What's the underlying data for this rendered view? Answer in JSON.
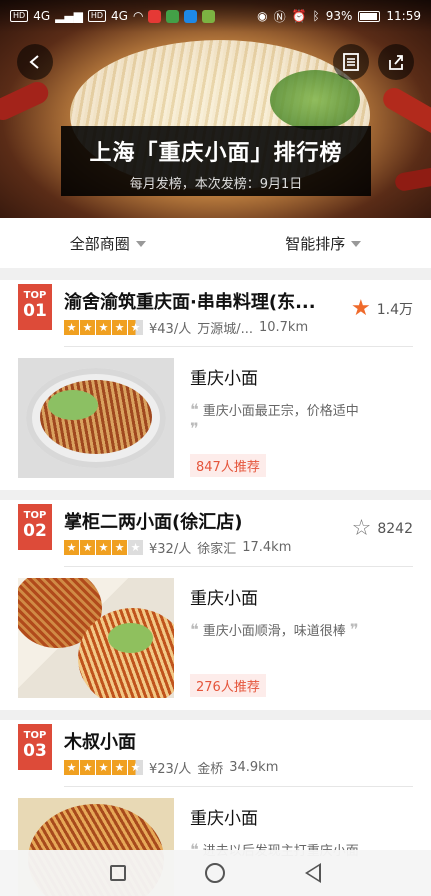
{
  "status_bar": {
    "net_chip_1": "HD",
    "net_chip_2": "HD",
    "signal_1": "4G",
    "signal_2": "4G",
    "battery_pct": "93%",
    "time": "11:59"
  },
  "header": {
    "title": "上海「重庆小面」排行榜",
    "subtitle": "每月发榜，本次发榜：9月1日"
  },
  "filters": [
    {
      "label": "全部商圈"
    },
    {
      "label": "智能排序"
    }
  ],
  "colors": {
    "accent": "#dd4b39",
    "star": "#f0a020",
    "fav": "#ef6a2b"
  },
  "shops": [
    {
      "badge_top": "TOP",
      "badge_num": "01",
      "name": "渝舍渝筑重庆面·串串料理(东...",
      "rating_stars": 4.5,
      "price": "¥43/人",
      "area": "万源城/...",
      "distance": "10.7km",
      "favorited": true,
      "fav_count": "1.4万",
      "dish_name": "重庆小面",
      "review": "重庆小面最正宗，价格适中",
      "recommend": "847人推荐"
    },
    {
      "badge_top": "TOP",
      "badge_num": "02",
      "name": "掌柜二两小面(徐汇店)",
      "rating_stars": 4,
      "price": "¥32/人",
      "area": "徐家汇",
      "distance": "17.4km",
      "favorited": false,
      "fav_count": "8242",
      "dish_name": "重庆小面",
      "review": "重庆小面顺滑，味道很棒",
      "recommend": "276人推荐"
    },
    {
      "badge_top": "TOP",
      "badge_num": "03",
      "name": "木叔小面",
      "rating_stars": 4.5,
      "price": "¥23/人",
      "area": "金桥",
      "distance": "34.9km",
      "dish_name": "重庆小面",
      "review": "进去以后发现主打重庆小面"
    }
  ]
}
